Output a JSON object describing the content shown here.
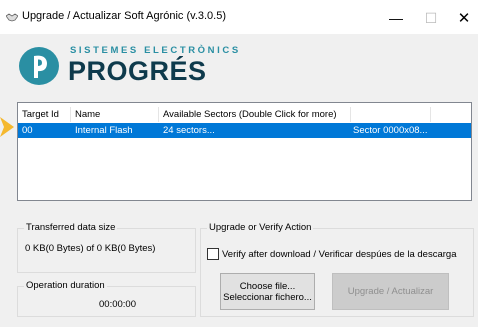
{
  "window": {
    "title": "Upgrade / Actualizar Soft Agrónic (v.3.0.5)",
    "minimize_glyph": "—",
    "maximize_glyph": "☐",
    "close_glyph": "✕"
  },
  "logo": {
    "subtitle": "SISTEMES ELECTRÒNICS",
    "brand": "PROGRÉS"
  },
  "table": {
    "columns": [
      "Target Id",
      "Name",
      "Available Sectors (Double Click for more)",
      ""
    ],
    "rows": [
      [
        "00",
        "Internal Flash",
        "24 sectors...",
        "Sector 0000x08..."
      ]
    ],
    "selected_row": 0,
    "selection_color": "#0078d7"
  },
  "transfer": {
    "label": "Transferred data size",
    "value": "0 KB(0 Bytes) of 0 KB(0 Bytes)"
  },
  "duration": {
    "label": "Operation duration",
    "value": "00:00:00"
  },
  "action": {
    "group_label": "Upgrade or Verify Action",
    "verify_checkbox_label": "Verify after download / Verificar despúes de la descarga",
    "verify_checked": false,
    "choose_button_line1": "Choose file...",
    "choose_button_line2": "Seleccionar fichero...",
    "upgrade_button_label": "Upgrade  / Actualizar",
    "upgrade_enabled": false
  },
  "colors": {
    "brand_dark": "#0e3a4c",
    "brand_teal": "#2a8fa3",
    "pointer_arrow": "#f5b82e"
  },
  "icons": {
    "app": "handshake-icon",
    "pointer": "arrow-pointer-icon",
    "logo_mark": "progres-logo-mark"
  }
}
